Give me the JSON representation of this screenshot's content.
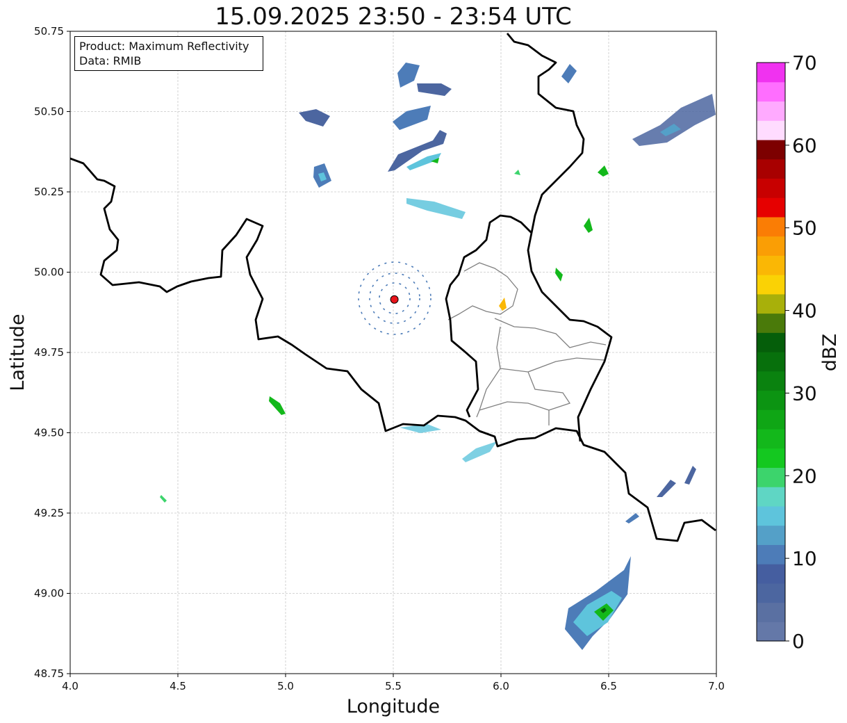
{
  "title": "15.09.2025 23:50 - 23:54 UTC",
  "info": {
    "product_line": "Product: Maximum Reflectivity",
    "data_line": "Data: RMIB"
  },
  "map": {
    "xlabel": "Longitude",
    "ylabel": "Latitude",
    "xlim": [
      4.0,
      7.0
    ],
    "ylim": [
      48.75,
      50.75
    ],
    "x_ticks": [
      "4.0",
      "4.5",
      "5.0",
      "5.5",
      "6.0",
      "6.5",
      "7.0"
    ],
    "y_ticks": [
      "48.75",
      "49.00",
      "49.25",
      "49.50",
      "49.75",
      "50.00",
      "50.25",
      "50.50",
      "50.75"
    ],
    "grid": true,
    "radar_site": {
      "lon": 5.505,
      "lat": 49.915,
      "color": "#e8141b"
    },
    "border_color": "#000000",
    "province_color": "#808080"
  },
  "colorbar": {
    "label": "dBZ",
    "ticks": [
      "0",
      "10",
      "20",
      "30",
      "40",
      "50",
      "60",
      "70"
    ],
    "range": [
      0,
      70
    ],
    "colors": [
      "#6478a8",
      "#5a70a2",
      "#4c66a0",
      "#455ea0",
      "#4d7cb8",
      "#54a0c8",
      "#5ec4dc",
      "#5fd6c4",
      "#3cd46c",
      "#14c820",
      "#13b81b",
      "#0fa615",
      "#0c9412",
      "#0a820f",
      "#07700c",
      "#055e0a",
      "#4a7a0a",
      "#a8b00a",
      "#fad205",
      "#fab705",
      "#fa9e05",
      "#fa7d05",
      "#e60000",
      "#c80000",
      "#a80000",
      "#7d0000",
      "#ffdcff",
      "#ffaaff",
      "#ff6eff",
      "#f032f0"
    ]
  }
}
